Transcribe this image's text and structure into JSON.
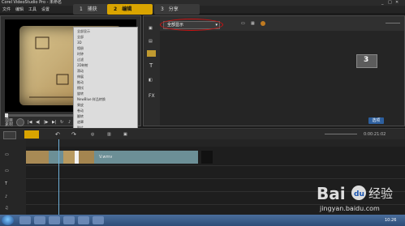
{
  "window": {
    "title": "Corel VideoStudio Pro - 未命名"
  },
  "menu": {
    "items": [
      "文件",
      "编辑",
      "工具",
      "设置"
    ]
  },
  "steps": [
    {
      "number": "1",
      "label": "捕获"
    },
    {
      "number": "2",
      "label": "编辑"
    },
    {
      "number": "3",
      "label": "分享"
    }
  ],
  "library": {
    "dropdown_value": "全部显示",
    "dropdown_options": [
      "全部显示",
      "全部",
      "3D",
      "相册",
      "时钟",
      "过滤",
      "2D映射",
      "滑动",
      "伸展",
      "推动",
      "擦拭",
      "旋转",
      "NewBlue 样品转换",
      "果皮",
      "卷动",
      "翻转",
      "遮罩",
      "胶片",
      "擦拭",
      "收藏夹"
    ],
    "button_label": "选项"
  },
  "preview": {
    "mode_project": "项目",
    "mode_clip": "素材"
  },
  "timeline": {
    "timecode": "0:00:21:02",
    "clip_label": "V.wmv"
  },
  "watermark": {
    "brand": "Bai",
    "paw": "du",
    "suffix": "经验",
    "url": "jingyan.baidu.com"
  },
  "taskbar": {
    "clock": "10:26"
  },
  "colors": {
    "accent": "#d9a400",
    "highlight_circle": "#d01010",
    "clip": "#6c8f96",
    "playhead": "#6fb0d8"
  }
}
